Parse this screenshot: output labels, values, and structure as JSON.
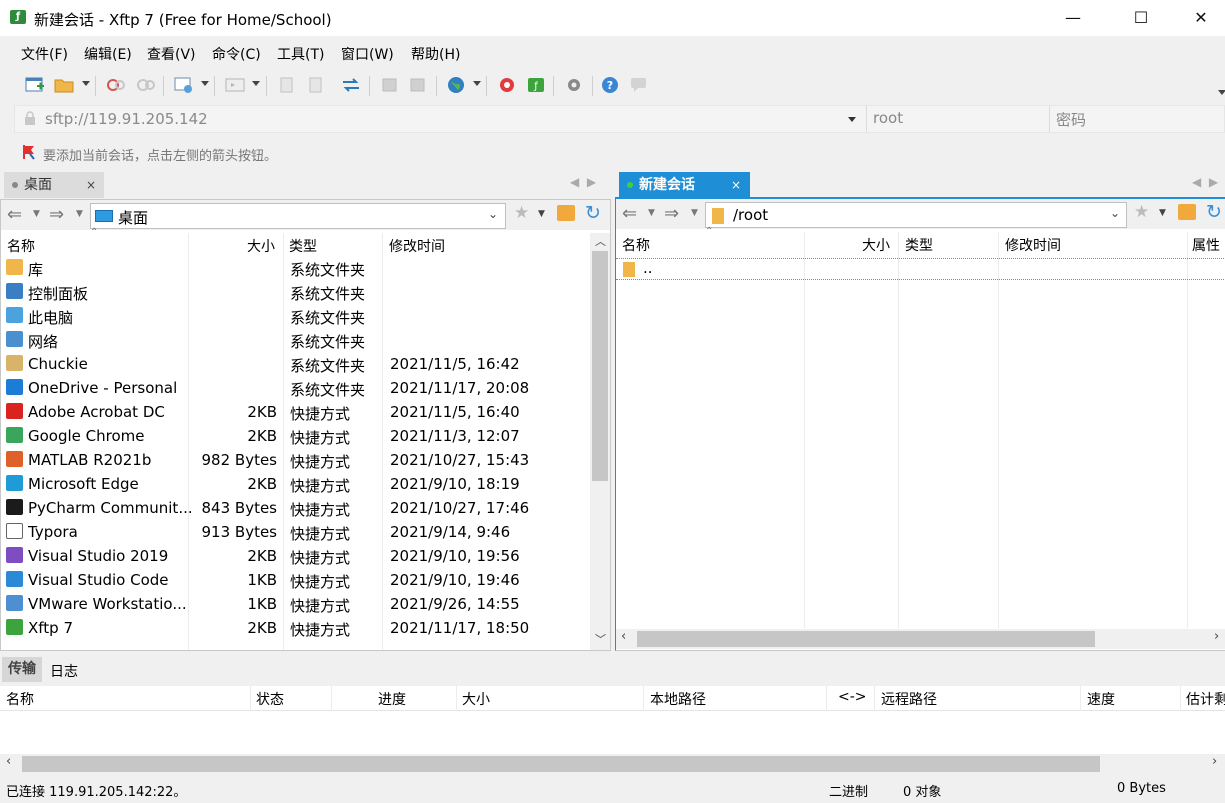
{
  "window": {
    "title": "新建会话 - Xftp 7 (Free for Home/School)",
    "minimize": "—",
    "maximize": "☐",
    "close": "✕"
  },
  "menu": [
    "文件(F)",
    "编辑(E)",
    "查看(V)",
    "命令(C)",
    "工具(T)",
    "窗口(W)",
    "帮助(H)"
  ],
  "address": {
    "host": "sftp://119.91.205.142",
    "user_placeholder": "root",
    "password_placeholder": "密码"
  },
  "hint": "要添加当前会话，点击左侧的箭头按钮。",
  "left_pane": {
    "tab_label": "桌面",
    "tab_close": "×",
    "path": "桌面",
    "columns": [
      "名称",
      "大小",
      "类型",
      "修改时间"
    ],
    "rows": [
      {
        "name": "库",
        "size": "",
        "type": "系统文件夹",
        "modified": "",
        "icon": "library-icon"
      },
      {
        "name": "控制面板",
        "size": "",
        "type": "系统文件夹",
        "modified": "",
        "icon": "control-panel-icon"
      },
      {
        "name": "此电脑",
        "size": "",
        "type": "系统文件夹",
        "modified": "",
        "icon": "computer-icon"
      },
      {
        "name": "网络",
        "size": "",
        "type": "系统文件夹",
        "modified": "",
        "icon": "network-icon"
      },
      {
        "name": "Chuckie",
        "size": "",
        "type": "系统文件夹",
        "modified": "2021/11/5, 16:42",
        "icon": "user-folder-icon"
      },
      {
        "name": "OneDrive - Personal",
        "size": "",
        "type": "系统文件夹",
        "modified": "2021/11/17, 20:08",
        "icon": "onedrive-icon"
      },
      {
        "name": "Adobe Acrobat DC",
        "size": "2KB",
        "type": "快捷方式",
        "modified": "2021/11/5, 16:40",
        "icon": "acrobat-icon"
      },
      {
        "name": "Google Chrome",
        "size": "2KB",
        "type": "快捷方式",
        "modified": "2021/11/3, 12:07",
        "icon": "chrome-icon"
      },
      {
        "name": "MATLAB R2021b",
        "size": "982 Bytes",
        "type": "快捷方式",
        "modified": "2021/10/27, 15:43",
        "icon": "matlab-icon"
      },
      {
        "name": "Microsoft Edge",
        "size": "2KB",
        "type": "快捷方式",
        "modified": "2021/9/10, 18:19",
        "icon": "edge-icon"
      },
      {
        "name": "PyCharm Communit...",
        "size": "843 Bytes",
        "type": "快捷方式",
        "modified": "2021/10/27, 17:46",
        "icon": "pycharm-icon"
      },
      {
        "name": "Typora",
        "size": "913 Bytes",
        "type": "快捷方式",
        "modified": "2021/9/14, 9:46",
        "icon": "typora-icon"
      },
      {
        "name": "Visual Studio 2019",
        "size": "2KB",
        "type": "快捷方式",
        "modified": "2021/9/10, 19:56",
        "icon": "visual-studio-icon"
      },
      {
        "name": "Visual Studio Code",
        "size": "1KB",
        "type": "快捷方式",
        "modified": "2021/9/10, 19:46",
        "icon": "vscode-icon"
      },
      {
        "name": "VMware Workstatio...",
        "size": "1KB",
        "type": "快捷方式",
        "modified": "2021/9/26, 14:55",
        "icon": "vmware-icon"
      },
      {
        "name": "Xftp 7",
        "size": "2KB",
        "type": "快捷方式",
        "modified": "2021/11/17, 18:50",
        "icon": "xftp-icon"
      }
    ]
  },
  "right_pane": {
    "tab_label": "新建会话",
    "tab_close": "×",
    "path": "/root",
    "columns": [
      "名称",
      "大小",
      "类型",
      "修改时间",
      "属性"
    ],
    "rows": [
      {
        "name": "..",
        "icon": "folder-icon"
      }
    ]
  },
  "bottom": {
    "tabs": [
      "传输",
      "日志"
    ],
    "columns": [
      "名称",
      "状态",
      "进度",
      "大小",
      "本地路径",
      "<->",
      "远程路径",
      "速度",
      "估计剩"
    ]
  },
  "status": {
    "connection": "已连接 119.91.205.142:22。",
    "mode": "二进制",
    "objects": "0 对象",
    "bytes": "0 Bytes"
  },
  "colors": {
    "accent": "#1e8fd6",
    "session_tab": "#1e8fd6",
    "desktop_tab": "#dcdcdc"
  }
}
